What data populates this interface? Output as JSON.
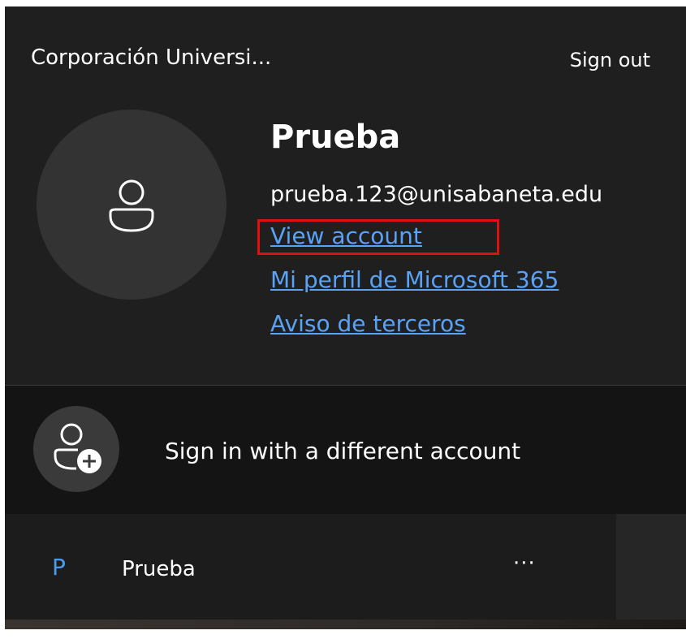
{
  "header": {
    "org_name": "Corporación Universi...",
    "sign_out_label": "Sign out"
  },
  "account": {
    "name": "Prueba",
    "email": "prueba.123@unisabaneta.edu",
    "links": {
      "view_account": "View account",
      "profile": "Mi perfil de Microsoft 365",
      "third_party": "Aviso de terceros"
    },
    "avatar_icon": "person-icon"
  },
  "other_account": {
    "label": "Sign in with a different account",
    "icon": "person-add-icon"
  },
  "accounts_list": [
    {
      "initial": "P",
      "name": "Prueba",
      "more_label": "···"
    }
  ],
  "colors": {
    "background": "#1f1f1f",
    "link": "#5aa2f5",
    "highlight": "#e01010",
    "initial": "#4a9be8"
  }
}
